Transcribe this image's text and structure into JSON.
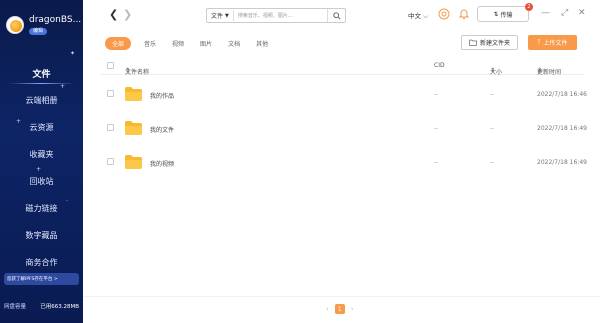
{
  "user": {
    "name": "dragonBS...",
    "badge": "编辑"
  },
  "sidebar": {
    "items": [
      {
        "label": "文件",
        "active": true
      },
      {
        "label": "云端相册"
      },
      {
        "label": "云资源"
      },
      {
        "label": "收藏夹"
      },
      {
        "label": "回收站"
      },
      {
        "label": "磁力链接"
      },
      {
        "label": "数字藏品"
      },
      {
        "label": "商务合作"
      }
    ],
    "promo": "您获了解IPFS存在平台 >",
    "storage_label": "网盘容量",
    "storage_used": "已用663.28MB"
  },
  "header": {
    "search_type": "文件",
    "search_placeholder": "搜索音乐、视频、图片...",
    "lang": "中文",
    "transfer_label": "传输",
    "transfer_count": "2"
  },
  "tabs": [
    "全部",
    "音乐",
    "视频",
    "图片",
    "文档",
    "其他"
  ],
  "actions": {
    "new_folder": "新建文件夹",
    "upload": "上传文件"
  },
  "table": {
    "columns": {
      "name": "文件名称",
      "cid": "CID",
      "size": "大小",
      "date": "更新时间"
    },
    "rows": [
      {
        "name": "我的作品",
        "cid": "--",
        "size": "--",
        "date": "2022/7/18 16:46"
      },
      {
        "name": "我的文件",
        "cid": "--",
        "size": "--",
        "date": "2022/7/18 16:49"
      },
      {
        "name": "我的视频",
        "cid": "--",
        "size": "--",
        "date": "2022/7/18 16:49"
      }
    ]
  },
  "pagination": {
    "current": "1"
  },
  "colors": {
    "accent": "#f89a4a",
    "sidebar": "#0d2466",
    "folder": "#f8b92c"
  }
}
